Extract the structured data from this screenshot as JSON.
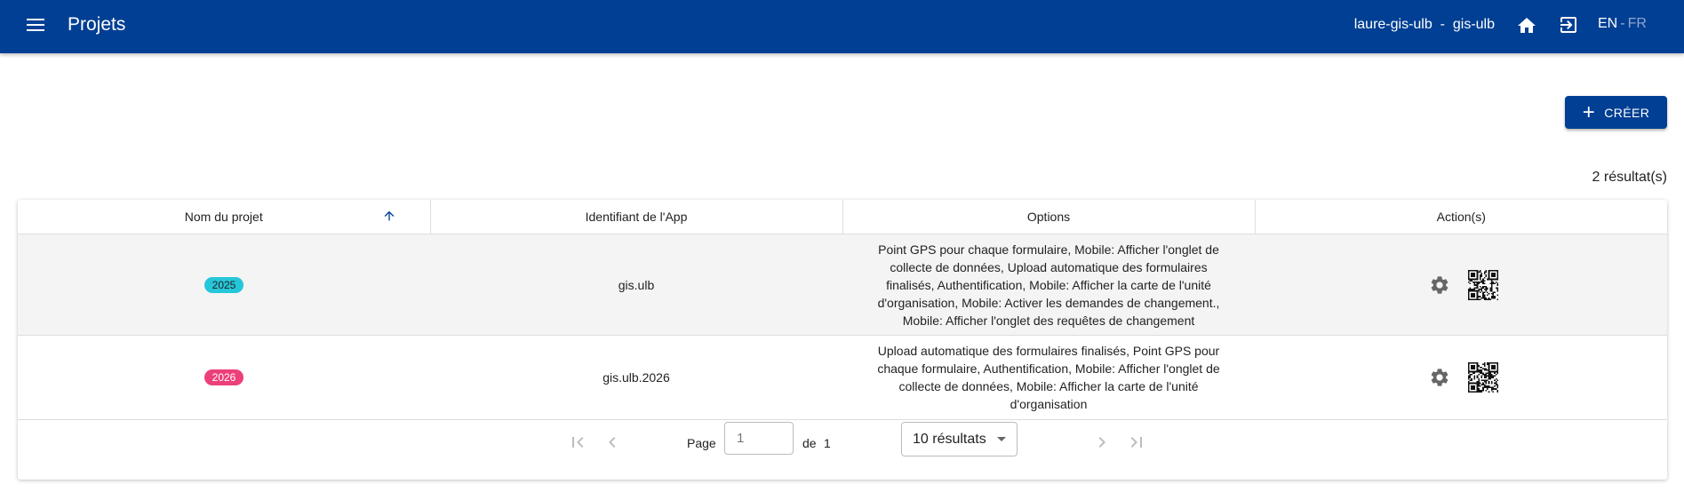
{
  "header": {
    "title": "Projets",
    "user": "laure-gis-ulb  -  gis-ulb",
    "lang_en": "EN",
    "lang_sep": "-",
    "lang_fr": "FR"
  },
  "toolbar": {
    "create_label": "CRÉER"
  },
  "results": {
    "count": "2 résultat(s)"
  },
  "table": {
    "columns": [
      "Nom du projet",
      "Identifiant de l'App",
      "Options",
      "Action(s)"
    ],
    "rows": [
      {
        "name": "2025",
        "badge_color": "#26c6da",
        "app_id": "gis.ulb",
        "options": "Point GPS pour chaque formulaire, Mobile: Afficher l'onglet de collecte de données, Upload automatique des formulaires finalisés, Authentification, Mobile: Afficher la carte de l'unité d'organisation, Mobile: Activer les demandes de changement., Mobile: Afficher l'onglet des requêtes de changement"
      },
      {
        "name": "2026",
        "badge_color": "#ec407a",
        "app_id": "gis.ulb.2026",
        "options": "Upload automatique des formulaires finalisés, Point GPS pour chaque formulaire, Authentification, Mobile: Afficher l'onglet de collecte de données, Mobile: Afficher la carte de l'unité d'organisation"
      }
    ]
  },
  "pagination": {
    "page_label": "Page",
    "page_value": "1",
    "of_label": "de",
    "total_pages": "1",
    "page_size": "10 résultats"
  },
  "colors": {
    "primary": "#003f93"
  }
}
